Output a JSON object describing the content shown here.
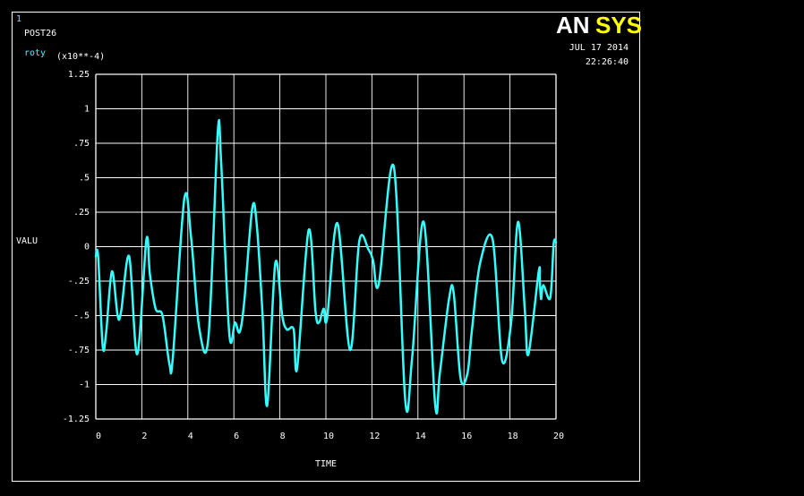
{
  "window": {
    "number": "1",
    "program": "POST26",
    "logo_an": "AN",
    "logo_sys": "SYS",
    "date": "JUL 17 2014",
    "time": "22:26:40"
  },
  "colors": {
    "background": "#000000",
    "frame": "#ffffff",
    "grid": "#ffffff",
    "text": "#ffffff",
    "curve": "#33ffff",
    "number": "#33ffff",
    "logo_sys": "#ffff00"
  },
  "chart_data": {
    "type": "line",
    "ylabel": "VALU",
    "xlabel": "TIME",
    "y_multiplier": "(x10**-4)",
    "xlim": [
      0,
      20
    ],
    "ylim": [
      -1.25,
      1.25
    ],
    "x_ticks": [
      0,
      2,
      4,
      6,
      8,
      10,
      12,
      14,
      16,
      18,
      20
    ],
    "x_tick_labels": [
      "0",
      "2",
      "4",
      "6",
      "8",
      "10",
      "12",
      "14",
      "16",
      "18",
      "20"
    ],
    "y_ticks": [
      1.25,
      1,
      0.75,
      0.5,
      0.25,
      0,
      -0.25,
      -0.5,
      -0.75,
      -1,
      -1.25
    ],
    "y_tick_labels": [
      "1.25",
      "1",
      ".75",
      ".5",
      ".25",
      "0",
      "-.25",
      "-.5",
      "-.75",
      "-1",
      "-1.25"
    ],
    "grid": true,
    "series": [
      {
        "name": "roty",
        "x": [
          0,
          0.1,
          0.3,
          0.45,
          0.7,
          0.95,
          1.1,
          1.45,
          1.8,
          2.2,
          2.35,
          2.6,
          2.9,
          3.2,
          3.35,
          3.85,
          4.15,
          4.5,
          4.9,
          5.3,
          5.45,
          5.8,
          6.05,
          6.25,
          6.45,
          6.8,
          7.0,
          7.25,
          7.45,
          7.8,
          8.1,
          8.3,
          8.6,
          8.75,
          9.25,
          9.55,
          9.7,
          9.9,
          10.05,
          10.5,
          11.05,
          11.45,
          11.85,
          12.05,
          12.3,
          12.95,
          13.45,
          13.75,
          14.25,
          14.75,
          14.95,
          15.35,
          15.55,
          15.85,
          16.15,
          16.35,
          16.7,
          17.25,
          17.65,
          18.05,
          18.35,
          18.65,
          18.8,
          19.25,
          19.3,
          19.35,
          19.45,
          19.75,
          19.9,
          20.0
        ],
        "values": [
          -0.07,
          -0.07,
          -0.72,
          -0.62,
          -0.18,
          -0.5,
          -0.47,
          -0.07,
          -0.78,
          0.05,
          -0.2,
          -0.45,
          -0.5,
          -0.85,
          -0.8,
          0.35,
          0.05,
          -0.6,
          -0.65,
          0.83,
          0.6,
          -0.63,
          -0.55,
          -0.62,
          -0.4,
          0.28,
          0.15,
          -0.5,
          -1.15,
          -0.12,
          -0.5,
          -0.6,
          -0.6,
          -0.88,
          0.12,
          -0.47,
          -0.55,
          -0.45,
          -0.52,
          0.17,
          -0.75,
          0.04,
          -0.02,
          -0.1,
          -0.27,
          0.58,
          -1.12,
          -0.8,
          0.18,
          -1.15,
          -0.92,
          -0.38,
          -0.33,
          -0.95,
          -0.92,
          -0.6,
          -0.12,
          0.05,
          -0.82,
          -0.55,
          0.18,
          -0.47,
          -0.78,
          -0.18,
          -0.25,
          -0.38,
          -0.28,
          -0.37,
          0.02,
          0.03
        ]
      }
    ]
  }
}
